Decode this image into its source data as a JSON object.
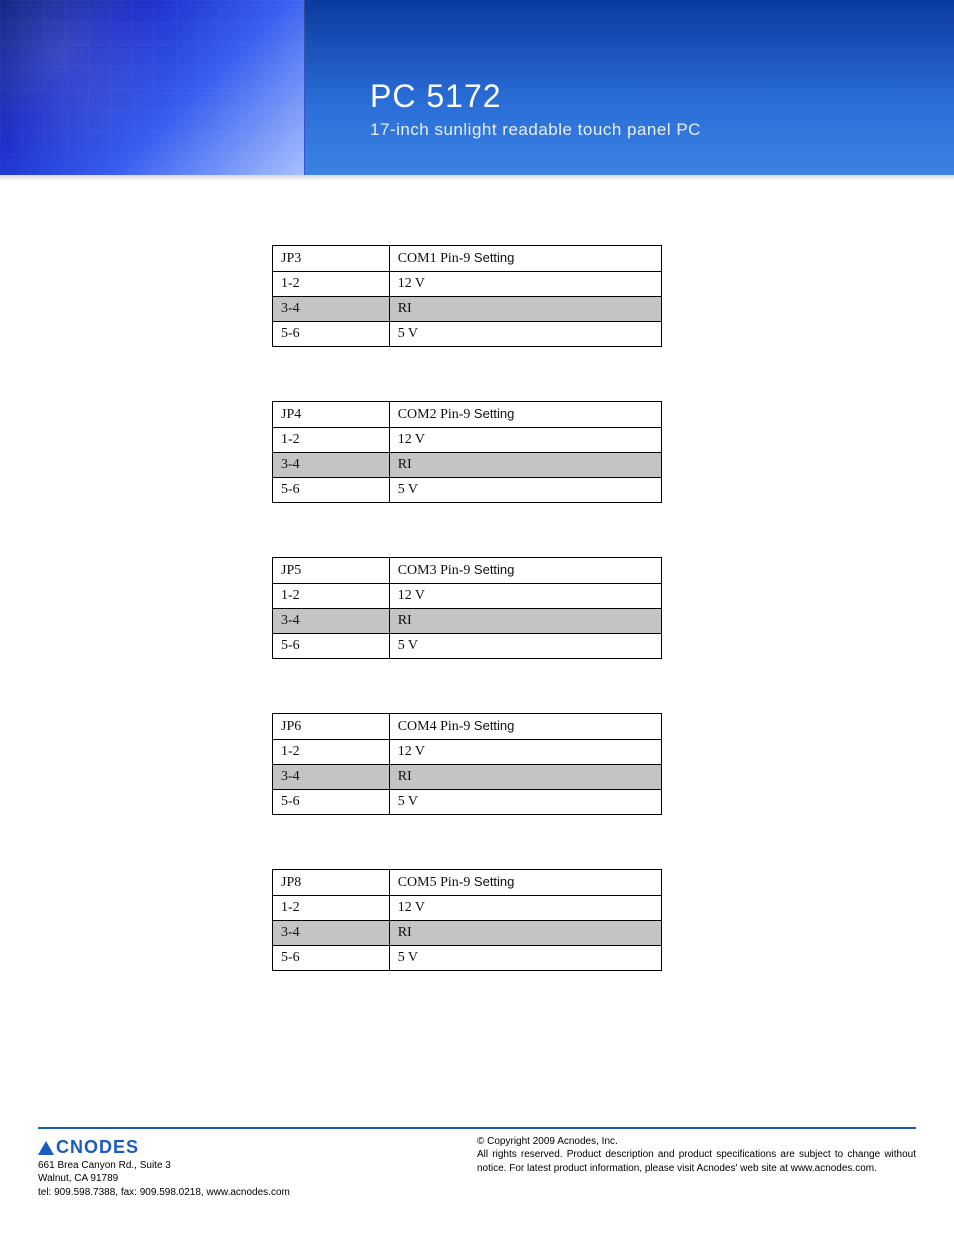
{
  "header": {
    "title": "PC 5172",
    "subtitle": "17-inch sunlight readable touch panel PC"
  },
  "tables": [
    {
      "jumper": "JP3",
      "setting_prefix": "COM1 Pin-9",
      "setting_suffix": "Setting",
      "rows": [
        {
          "pins": "1-2",
          "value": "12 V",
          "shaded": false
        },
        {
          "pins": "3-4",
          "value": "RI",
          "shaded": true
        },
        {
          "pins": "5-6",
          "value": "5 V",
          "shaded": false
        }
      ]
    },
    {
      "jumper": "JP4",
      "setting_prefix": "COM2 Pin-9",
      "setting_suffix": "Setting",
      "rows": [
        {
          "pins": "1-2",
          "value": "12 V",
          "shaded": false
        },
        {
          "pins": "3-4",
          "value": "RI",
          "shaded": true
        },
        {
          "pins": "5-6",
          "value": "5 V",
          "shaded": false
        }
      ]
    },
    {
      "jumper": "JP5",
      "setting_prefix": "COM3 Pin-9",
      "setting_suffix": "Setting",
      "rows": [
        {
          "pins": "1-2",
          "value": "12 V",
          "shaded": false
        },
        {
          "pins": "3-4",
          "value": "RI",
          "shaded": true
        },
        {
          "pins": "5-6",
          "value": "5 V",
          "shaded": false
        }
      ]
    },
    {
      "jumper": "JP6",
      "setting_prefix": "COM4 Pin-9",
      "setting_suffix": "Setting",
      "rows": [
        {
          "pins": "1-2",
          "value": "12 V",
          "shaded": false
        },
        {
          "pins": "3-4",
          "value": "RI",
          "shaded": true
        },
        {
          "pins": "5-6",
          "value": "5 V",
          "shaded": false
        }
      ]
    },
    {
      "jumper": "JP8",
      "setting_prefix": "COM5 Pin-9",
      "setting_suffix": "Setting",
      "rows": [
        {
          "pins": "1-2",
          "value": "12 V",
          "shaded": false
        },
        {
          "pins": "3-4",
          "value": "RI",
          "shaded": true
        },
        {
          "pins": "5-6",
          "value": "5 V",
          "shaded": false
        }
      ]
    }
  ],
  "footer": {
    "logo_text": "CNODES",
    "address1": "661 Brea Canyon Rd., Suite 3",
    "address2": "Walnut, CA 91789",
    "contact": "tel: 909.598.7388, fax: 909.598.0218, www.acnodes.com",
    "copyright": "© Copyright 2009 Acnodes, Inc.",
    "rights": "All rights reserved. Product description and product specifications are subject to change without notice. For latest product information, please visit Acnodes' web site at www.acnodes.com."
  }
}
